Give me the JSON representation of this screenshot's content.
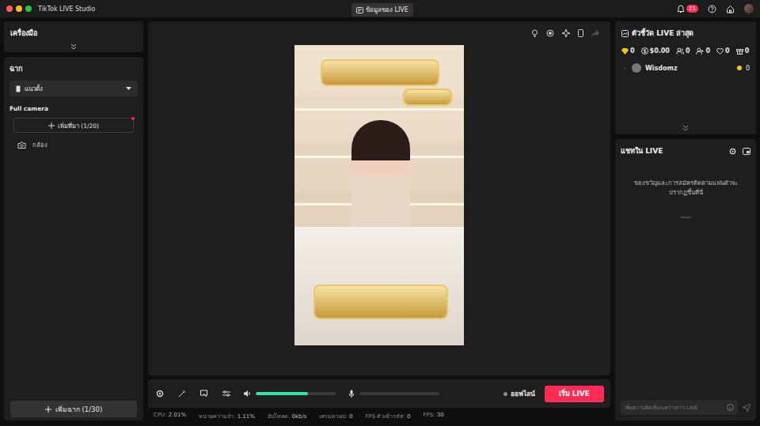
{
  "window": {
    "title": "TikTok LIVE Studio",
    "center_button": "ข้อมูลของ LIVE",
    "notifications": "21"
  },
  "tools": {
    "title": "เครื่องมือ"
  },
  "scenes": {
    "title": "ฉาก",
    "layout": "แนวตั้ง",
    "group": "Full camera",
    "add_source": "เพิ่มที่มา (1/20)",
    "add_source_alert": true,
    "sources": [
      {
        "name": "กล้อง"
      }
    ],
    "add_scene": "เพิ่มฉาก (1/30)"
  },
  "controls": {
    "volume_level": 0.65,
    "mic_level": 0,
    "status": "ออฟไลน์",
    "start_button": "เริ่ม LIVE"
  },
  "status_bar": [
    {
      "label": "CPU:",
      "value": "2.01%"
    },
    {
      "label": "หน่วยความจำ:",
      "value": "1.11%"
    },
    {
      "label": "อัปโหลด:",
      "value": "0kb/s"
    },
    {
      "label": "เฟรมดรอป:",
      "value": "0"
    },
    {
      "label": "FPS ตัวเข้ารหัส:",
      "value": "0"
    },
    {
      "label": "FPS:",
      "value": "30"
    }
  ],
  "metrics": {
    "title": "ตัวชี้วัด LIVE ล่าสุด",
    "stats": [
      {
        "kind": "diamond",
        "value": "0"
      },
      {
        "kind": "dollar",
        "value": "$0.00"
      },
      {
        "kind": "viewers",
        "value": "0"
      },
      {
        "kind": "followers",
        "value": "0"
      },
      {
        "kind": "likes",
        "value": "0"
      },
      {
        "kind": "gifts",
        "value": "0"
      }
    ],
    "viewers": [
      {
        "rank": "-",
        "name": "Wisdomz",
        "coins": "0"
      }
    ]
  },
  "chat": {
    "title": "แชทใน LIVE",
    "empty": "ของขวัญและการสมัครติดตามแฟนตัวจะปรากฏขึ้นที่นี่",
    "placeholder": "เพิ่มความคิดเห็นระหว่างการ LIVE"
  }
}
